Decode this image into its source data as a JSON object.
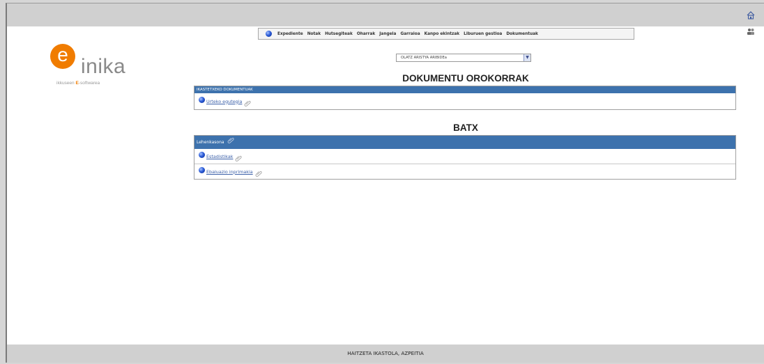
{
  "menu": {
    "items": [
      "Expediente",
      "Notak",
      "Hutsegiteak",
      "Oharrak",
      "Jangela",
      "Garraioa",
      "Kanpo ekintzak",
      "Liburuen gestioa",
      "Dokumentuak"
    ]
  },
  "logo": {
    "letter": "e",
    "word": "inika",
    "tag_prefix": "ikkuseen ",
    "tag_accent": "E",
    "tag_suffix": "-softwarea"
  },
  "selector": {
    "value": "OLATZ ARISTYA ARIBIDEa"
  },
  "sections": [
    {
      "title": "DOKUMENTU OROKORRAK",
      "header": "IKASTETXEKO DOKUMENTUAK",
      "rows": [
        {
          "label": "Urteko egutegia"
        }
      ]
    },
    {
      "title": "BATX",
      "header": "Lehenkasona",
      "rows": [
        {
          "label": "Estadistikak"
        },
        {
          "label": "Ebaluazio inprimakia"
        }
      ]
    }
  ],
  "footer": {
    "text": "HAITZETA IKASTOLA, AZPEITIA"
  },
  "colors": {
    "accent": "#3d72ad",
    "logo_orange": "#f07c00",
    "bar_gray": "#d0d0d0"
  },
  "icons": {
    "home": "home-icon",
    "users": "users-icon",
    "globe": "globe-icon",
    "attachment": "paperclip-icon"
  }
}
